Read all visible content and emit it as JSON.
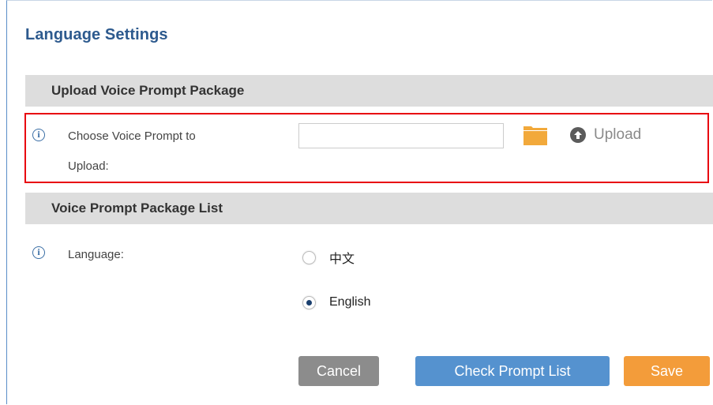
{
  "page": {
    "title": "Language Settings"
  },
  "upload_section": {
    "title": "Upload Voice Prompt Package",
    "field_label_line1": "Choose Voice Prompt to",
    "field_label_line2": "Upload:",
    "file_input_value": "",
    "folder_icon": "folder-icon",
    "upload_icon": "arrow-up-circle-icon",
    "upload_label": "Upload"
  },
  "list_section": {
    "title": "Voice Prompt Package List",
    "language_label": "Language:",
    "options": [
      {
        "label": "中文",
        "selected": false
      },
      {
        "label": "English",
        "selected": true
      }
    ]
  },
  "buttons": {
    "cancel": "Cancel",
    "check_prompt_list": "Check Prompt List",
    "save": "Save"
  },
  "colors": {
    "title": "#2d5a8e",
    "section_bg": "#dddddd",
    "highlight_border": "#e8000f",
    "folder": "#f2a93b",
    "cancel_bg": "#8c8c8c",
    "check_bg": "#5592cf",
    "save_bg": "#f39c3a"
  }
}
